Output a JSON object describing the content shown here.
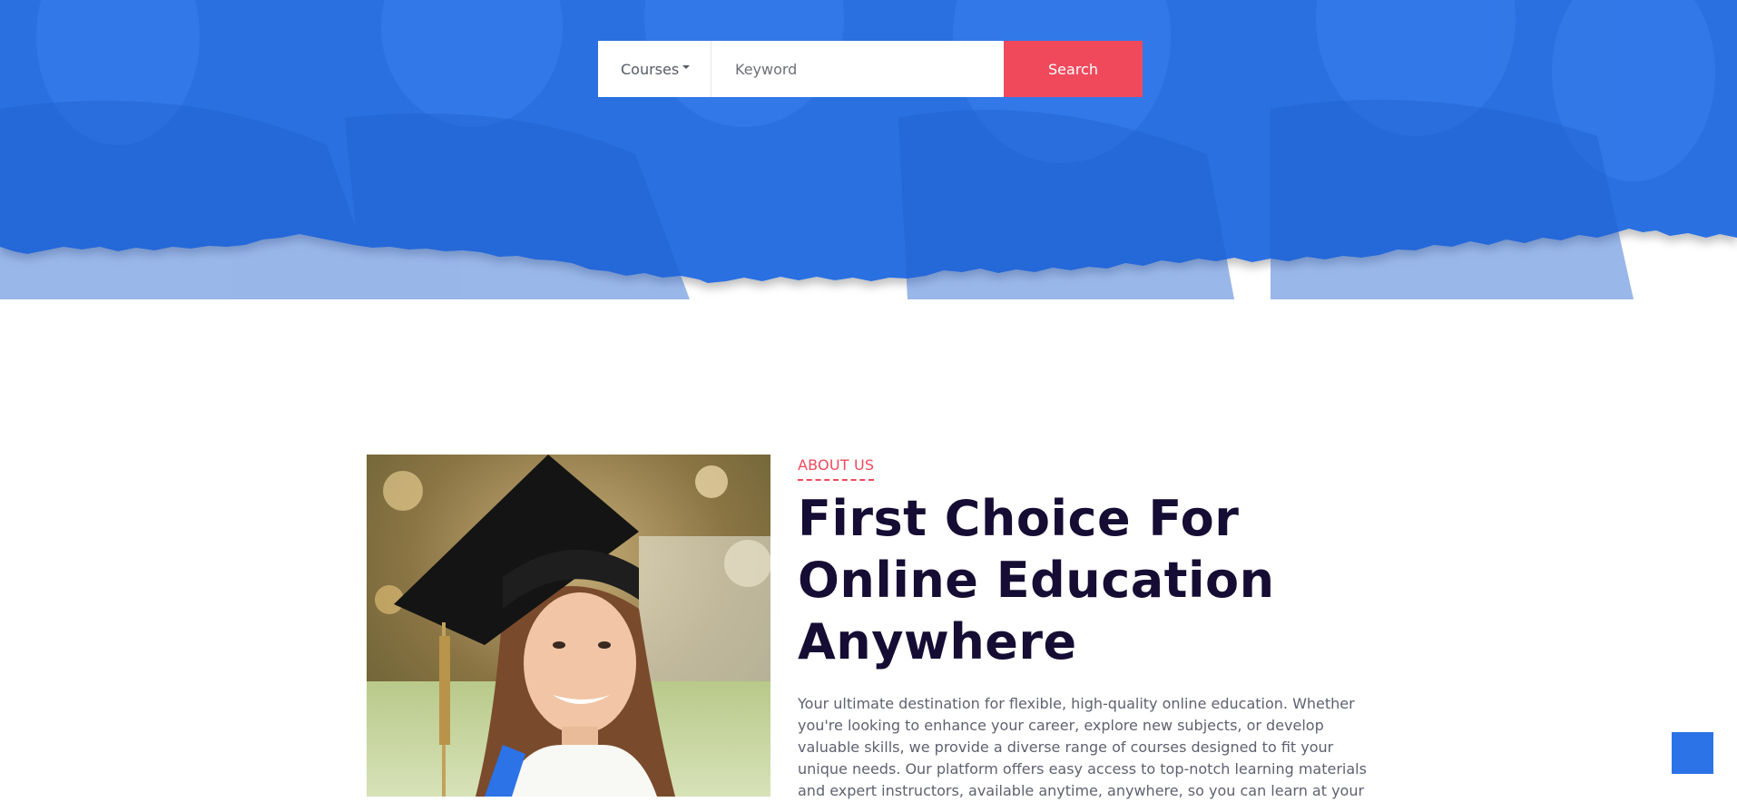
{
  "search": {
    "category_label": "Courses",
    "keyword_placeholder": "Keyword",
    "button_label": "Search"
  },
  "about": {
    "eyebrow": "ABOUT US",
    "title": "First Choice For Online Education Anywhere",
    "text": "Your ultimate destination for flexible, high-quality online education. Whether you're looking to enhance your career, explore new subjects, or develop valuable skills, we provide a diverse range of courses designed to fit your unique needs. Our platform offers easy access to top-notch learning materials and expert instructors, available anytime, anywhere, so you can learn at your"
  },
  "colors": {
    "hero_blue": "#2b73e6",
    "accent_red": "#f0495c",
    "title_navy": "#150d33"
  },
  "icons": {
    "back_to_top": "back-to-top-icon"
  }
}
